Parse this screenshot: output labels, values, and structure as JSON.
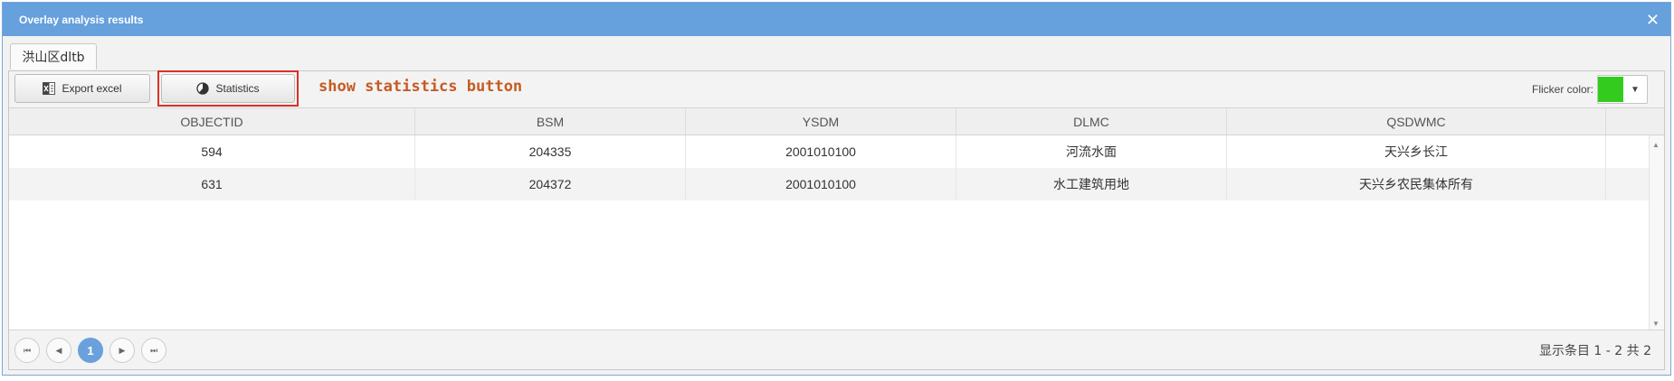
{
  "window": {
    "title": "Overlay analysis results",
    "close_glyph": "✕"
  },
  "tabs": [
    {
      "label": "洪山区dltb"
    }
  ],
  "toolbar": {
    "export_label": "Export excel",
    "export_icon": "excel-icon",
    "statistics_label": "Statistics",
    "statistics_icon": "pie-chart-icon",
    "annotation": "show statistics button",
    "flicker_label": "Flicker color:",
    "flicker_color": "#33cc1e",
    "dropdown_glyph": "▼"
  },
  "table": {
    "columns": [
      "OBJECTID",
      "BSM",
      "YSDM",
      "DLMC",
      "QSDWMC"
    ],
    "rows": [
      [
        "594",
        "204335",
        "2001010100",
        "河流水面",
        "天兴乡长江"
      ],
      [
        "631",
        "204372",
        "2001010100",
        "水工建筑用地",
        "天兴乡农民集体所有"
      ]
    ]
  },
  "pager": {
    "first": "⏮",
    "prev": "◀",
    "current": "1",
    "next": "▶",
    "last": "⏭",
    "info": "显示条目 1 - 2 共 2"
  },
  "colors": {
    "titlebar": "#66a0dd",
    "accent": "#6aa1dd",
    "annotation": "#c65b22",
    "highlight": "#d93025"
  }
}
